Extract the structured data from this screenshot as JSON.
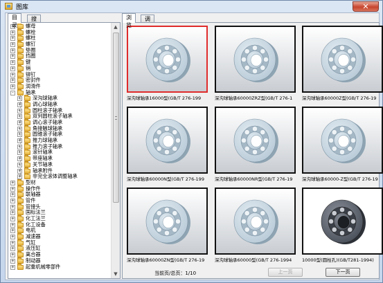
{
  "window": {
    "title": "图库",
    "close_glyph": "✕"
  },
  "left_panel": {
    "tabs": [
      {
        "label": "目录",
        "active": true
      },
      {
        "label": "搜索",
        "active": false
      }
    ],
    "tree": [
      {
        "label": "螺母",
        "level": 0,
        "expander": "+"
      },
      {
        "label": "螺栓",
        "level": 0,
        "expander": "+"
      },
      {
        "label": "螺柱",
        "level": 0,
        "expander": "+"
      },
      {
        "label": "螺钉",
        "level": 0,
        "expander": "+"
      },
      {
        "label": "垫圈",
        "level": 0,
        "expander": "+"
      },
      {
        "label": "挡圈",
        "level": 0,
        "expander": "+"
      },
      {
        "label": "键",
        "level": 0,
        "expander": "+"
      },
      {
        "label": "销",
        "level": 0,
        "expander": "+"
      },
      {
        "label": "铆钉",
        "level": 0,
        "expander": "+"
      },
      {
        "label": "密封件",
        "level": 0,
        "expander": "+"
      },
      {
        "label": "润滑件",
        "level": 0,
        "expander": "+"
      },
      {
        "label": "轴承",
        "level": 0,
        "expander": "-"
      },
      {
        "label": "深沟球轴承",
        "level": 1,
        "expander": "+"
      },
      {
        "label": "调心球轴承",
        "level": 1,
        "expander": "+"
      },
      {
        "label": "圆柱滚子轴承",
        "level": 1,
        "expander": "+"
      },
      {
        "label": "双列圆柱滚子轴承",
        "level": 1,
        "expander": "+"
      },
      {
        "label": "调心滚子轴承",
        "level": 1,
        "expander": "+"
      },
      {
        "label": "角接触球轴承",
        "level": 1,
        "expander": "+"
      },
      {
        "label": "圆锥滚子轴承",
        "level": 1,
        "expander": "+"
      },
      {
        "label": "推力球轴承",
        "level": 1,
        "expander": "+"
      },
      {
        "label": "推力滚子轴承",
        "level": 1,
        "expander": "+"
      },
      {
        "label": "滚针轴承",
        "level": 1,
        "expander": "+"
      },
      {
        "label": "带座轴承",
        "level": 1,
        "expander": "+"
      },
      {
        "label": "关节轴承",
        "level": 1,
        "expander": "+"
      },
      {
        "label": "轴承附件",
        "level": 1,
        "expander": "+"
      },
      {
        "label": "非完全滚体调整轴承",
        "level": 1,
        "expander": "+"
      },
      {
        "label": "型材",
        "level": 0,
        "expander": "+"
      },
      {
        "label": "操作件",
        "level": 0,
        "expander": "+"
      },
      {
        "label": "联轴器",
        "level": 0,
        "expander": "+"
      },
      {
        "label": "管件",
        "level": 0,
        "expander": "+"
      },
      {
        "label": "管接头",
        "level": 0,
        "expander": "+"
      },
      {
        "label": "国标法兰",
        "level": 0,
        "expander": "+"
      },
      {
        "label": "化工法兰",
        "level": 0,
        "expander": "+"
      },
      {
        "label": "化工设备",
        "level": 0,
        "expander": "+"
      },
      {
        "label": "电机",
        "level": 0,
        "expander": "+"
      },
      {
        "label": "减速器",
        "level": 0,
        "expander": "+"
      },
      {
        "label": "气缸",
        "level": 0,
        "expander": "+"
      },
      {
        "label": "液压缸",
        "level": 0,
        "expander": "+"
      },
      {
        "label": "离合器",
        "level": 0,
        "expander": "+"
      },
      {
        "label": "制动器",
        "level": 0,
        "expander": "+"
      },
      {
        "label": "起重机械零部件",
        "level": 0,
        "expander": "+"
      }
    ]
  },
  "right_panel": {
    "tabs": [
      {
        "label": "浏览",
        "active": true
      },
      {
        "label": "调用",
        "active": false
      }
    ],
    "items": [
      {
        "caption": "深沟球轴承16000型(GB/T  276-199",
        "style": "plain",
        "selected": true
      },
      {
        "caption": "深沟球轴承60000ZRZ型(GB/T  276-1",
        "style": "plain",
        "selected": false
      },
      {
        "caption": "深沟球轴承60000Z型(GB/T  276-19",
        "style": "plain",
        "selected": false
      },
      {
        "caption": "深沟球轴承60000N型(GB/T  276-199",
        "style": "plain",
        "selected": false
      },
      {
        "caption": "深沟球轴承60000NR型(GB/T  276-19",
        "style": "plain",
        "selected": false
      },
      {
        "caption": "深沟球轴承60000-Z型(GB/T  276-19",
        "style": "plain",
        "selected": false
      },
      {
        "caption": "深沟球轴承60000ZN型(GB/T  276-19",
        "style": "plain",
        "selected": false
      },
      {
        "caption": "深沟球轴承60000型(GB/T  276-1994",
        "style": "plain",
        "selected": false
      },
      {
        "caption": "10000型(圆柱孔)(GB/T281-1994)",
        "style": "dark",
        "selected": false
      }
    ],
    "pager": {
      "info": "当前页/总页：1/10",
      "prev_label": "上一页",
      "next_label": "下一页"
    }
  },
  "colors": {
    "selection_border": "#e02b2b",
    "bearing_plain": "#b9cbd8",
    "bearing_dark": "#4a505a"
  }
}
